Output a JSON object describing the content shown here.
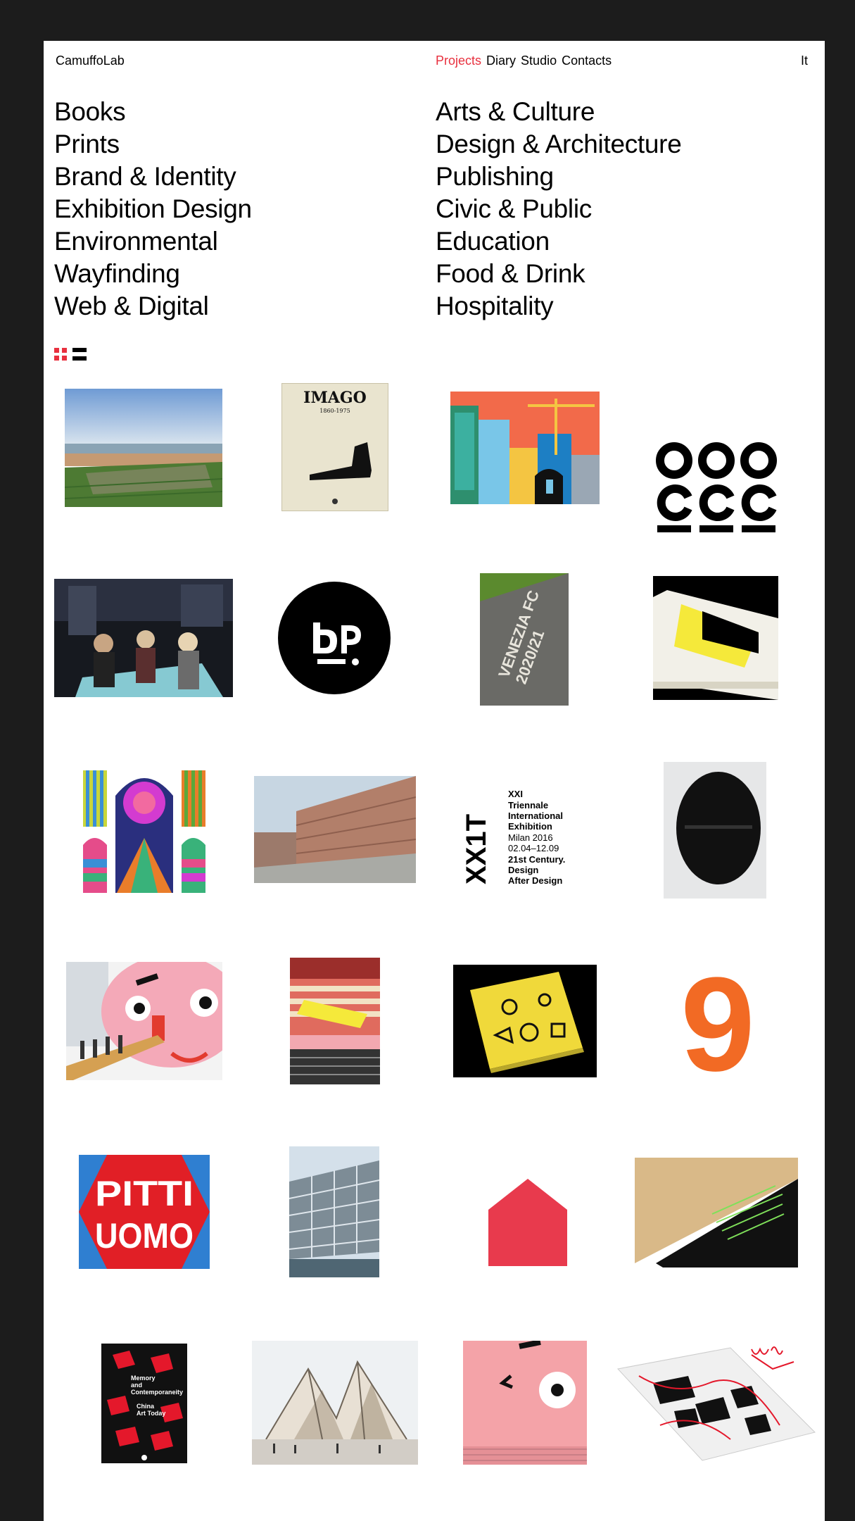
{
  "header": {
    "brand": "CamuffoLab",
    "nav": [
      "Projects",
      "Diary",
      "Studio",
      "Contacts"
    ],
    "active_nav": "Projects",
    "language": "It"
  },
  "categories_left": [
    "Books",
    "Prints",
    "Brand & Identity",
    "Exhibition Design",
    "Environmental",
    "Wayfinding",
    "Web & Digital"
  ],
  "categories_right": [
    "Arts & Culture",
    "Design & Architecture",
    "Publishing",
    "Civic & Public",
    "Education",
    "Food & Drink",
    "Hospitality"
  ],
  "colors": {
    "accent": "#e8303e",
    "frame": "#1c1c1c",
    "orange": "#f26a24"
  },
  "thumbnails": {
    "imago": {
      "title": "IMAGO",
      "subtitle": "1860-1975"
    },
    "venezia_fc": {
      "line1": "VENEZIA FC",
      "line2": "2020/21"
    },
    "triennale": {
      "mark": "XX1T",
      "lines": [
        "XXI",
        "Triennale",
        "International",
        "Exhibition",
        "Milan 2016",
        "02.04–12.09",
        "21st Century.",
        "Design",
        "After Design"
      ]
    },
    "nine": "9",
    "pitti": {
      "line1": "PITTI",
      "line2": "UOMO"
    },
    "memory": {
      "line1": "Memory",
      "line2": "and",
      "line3": "Contemporaneity",
      "line4": "China",
      "line5": "Art Today"
    }
  }
}
